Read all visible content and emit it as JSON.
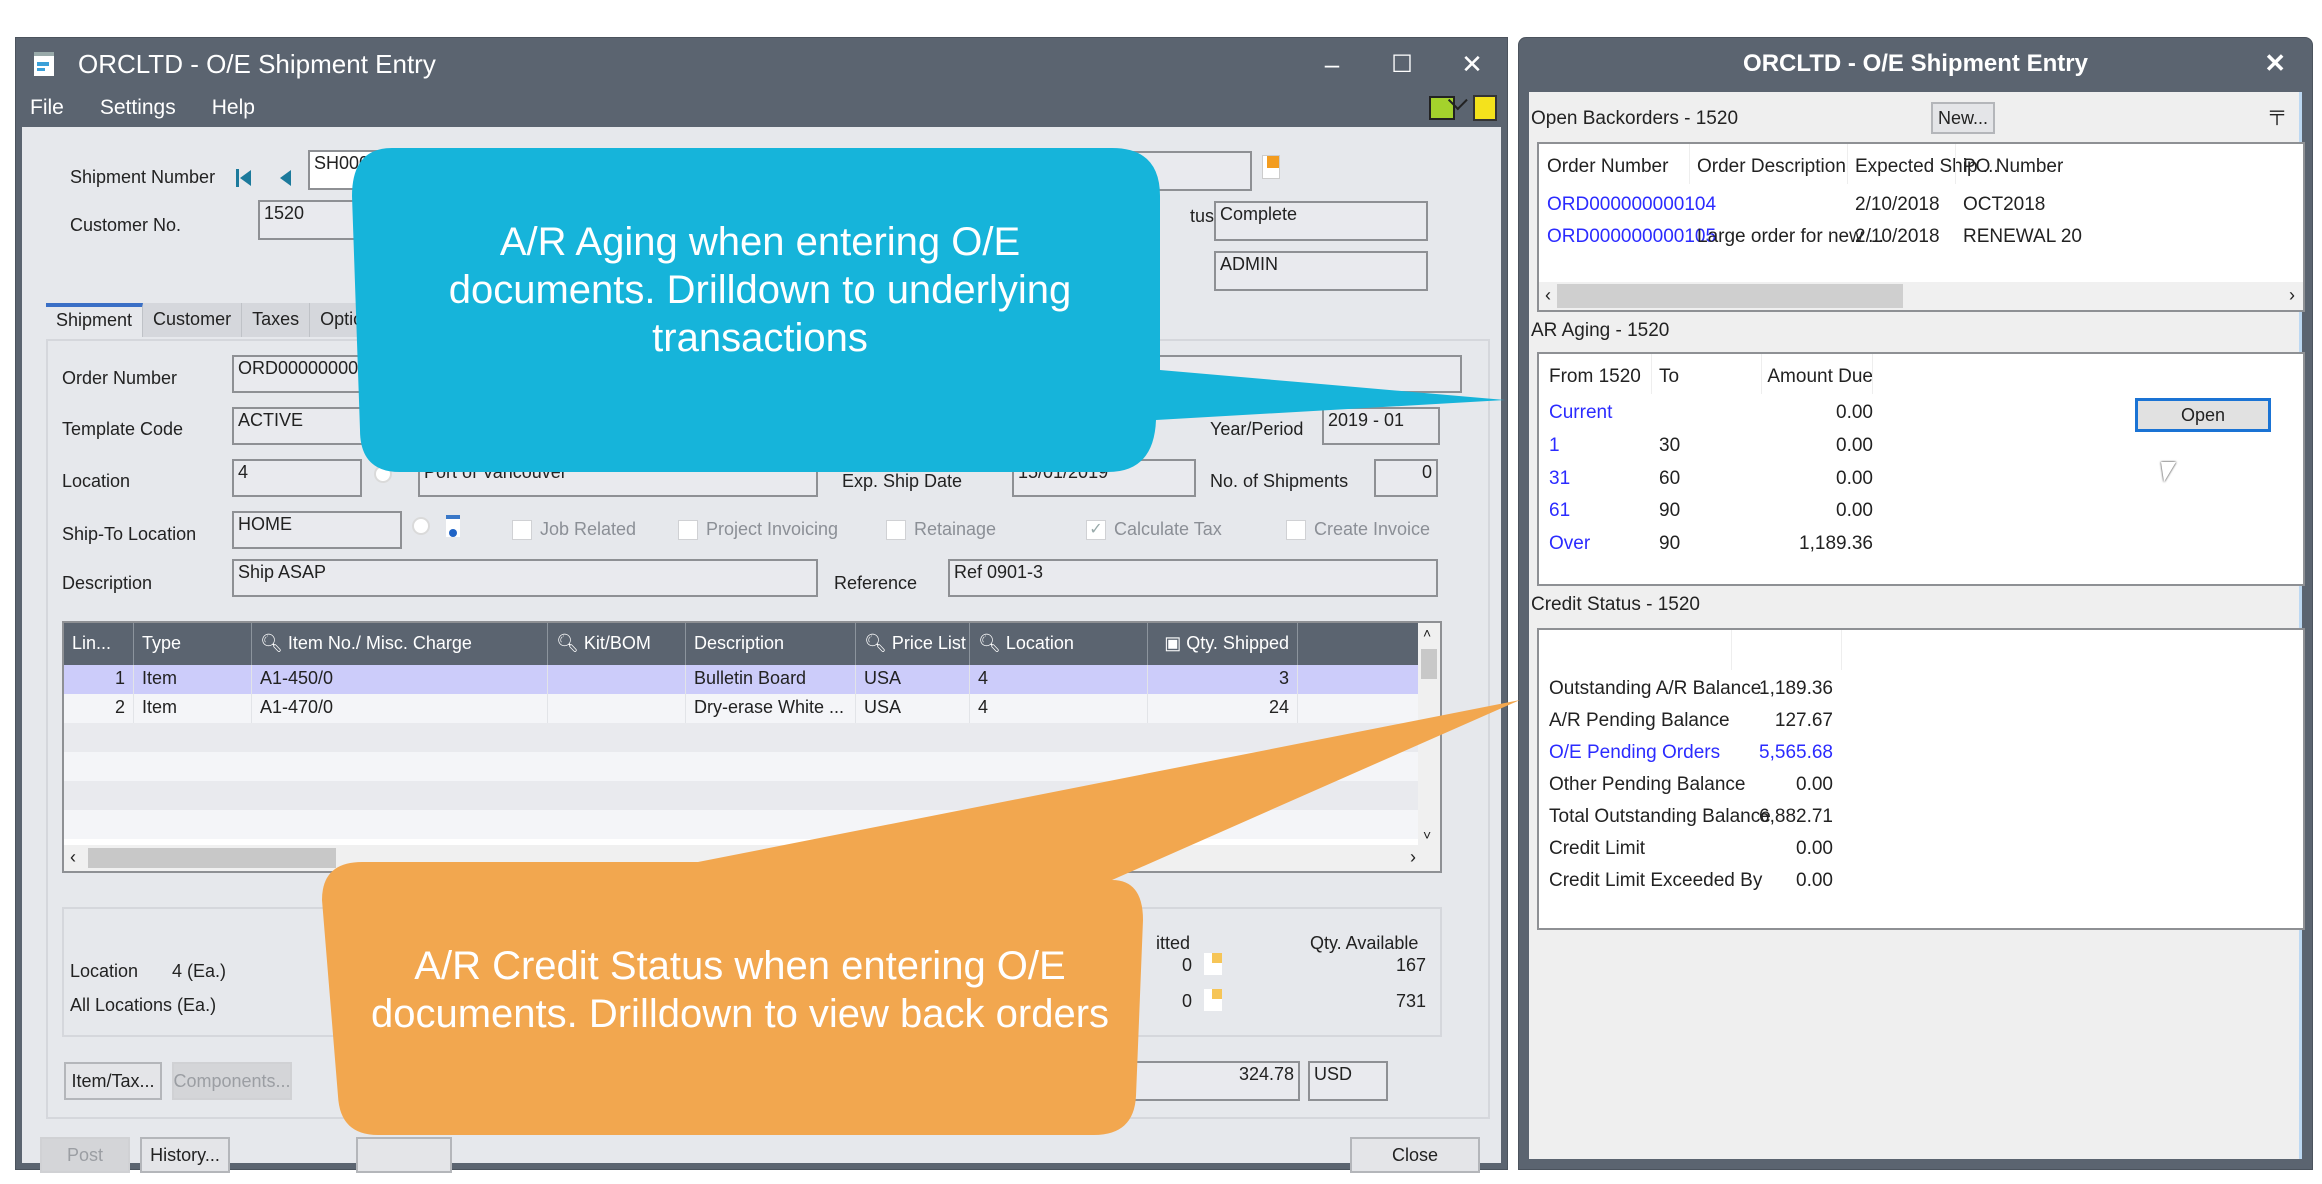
{
  "main_window": {
    "title": "ORCLTD - O/E Shipment Entry",
    "controls": {
      "minimize": "–",
      "maximize": "☐",
      "close": "✕"
    },
    "menu": [
      "File",
      "Settings",
      "Help"
    ],
    "header": {
      "shipment_number_label": "Shipment Number",
      "shipment_number_value": "SH000",
      "customer_no_label": "Customer No.",
      "customer_no_value": "1520",
      "status_label": "tus",
      "status_value": "Complete",
      "user_value": "ADMIN"
    },
    "tabs": [
      "Shipment",
      "Customer",
      "Taxes",
      "Optio"
    ],
    "form": {
      "order_number_label": "Order Number",
      "order_number_value": "ORD00000000",
      "template_code_label": "Template Code",
      "template_code_value": "ACTIVE",
      "year_period_label": "Year/Period",
      "year_period_value": "2019 - 01",
      "location_label": "Location",
      "location_value": "4",
      "location_desc": "Port of Vancouver",
      "exp_ship_date_label": "Exp. Ship Date",
      "exp_ship_date_value": "15/01/2019",
      "no_shipments_label": "No. of Shipments",
      "no_shipments_value": "0",
      "ship_to_label": "Ship-To Location",
      "ship_to_value": "HOME",
      "checkboxes": [
        {
          "label": "Job Related",
          "checked": false
        },
        {
          "label": "Project Invoicing",
          "checked": false
        },
        {
          "label": "Retainage",
          "checked": false
        },
        {
          "label": "Calculate Tax",
          "checked": true
        },
        {
          "label": "Create Invoice",
          "checked": false
        }
      ],
      "description_label": "Description",
      "description_value": "Ship ASAP",
      "reference_label": "Reference",
      "reference_value": "Ref 0901-3"
    },
    "grid": {
      "columns": [
        "Lin...",
        "Type",
        "Item No./ Misc. Charge",
        "Kit/BOM",
        "Description",
        "Price List",
        "Location",
        "Qty. Shipped"
      ],
      "rows": [
        [
          "1",
          "Item",
          "A1-450/0",
          "",
          "Bulletin Board",
          "USA",
          "4",
          "3"
        ],
        [
          "2",
          "Item",
          "A1-470/0",
          "",
          "Dry-erase White ...",
          "USA",
          "4",
          "24"
        ]
      ]
    },
    "availability": {
      "location_label": "Location",
      "location_value": "4 (Ea.)",
      "all_locations_label": "All Locations (Ea.)",
      "committed_header": "itted",
      "committed_values": [
        "0",
        "0"
      ],
      "qty_available_header": "Qty. Available",
      "qty_available_values": [
        "167",
        "731"
      ]
    },
    "buttons": {
      "item_tax": "Item/Tax...",
      "components": "Components...",
      "post": "Post",
      "history": "History...",
      "close": "Close"
    },
    "total_value": "324.78",
    "currency": "USD"
  },
  "side_window": {
    "title": "ORCLTD - O/E Shipment Entry",
    "close": "✕",
    "backorders": {
      "title": "Open Backorders - 1520",
      "new_button": "New...",
      "columns": [
        "Order Number",
        "Order Description",
        "Expected Ship ...",
        "PO Number"
      ],
      "rows": [
        [
          "ORD000000000104",
          "",
          "2/10/2018",
          "OCT2018"
        ],
        [
          "ORD000000000105",
          "Large order for new ...",
          "2/10/2018",
          "RENEWAL 20"
        ]
      ]
    },
    "aging": {
      "title": "AR Aging - 1520",
      "columns": [
        "From 1520",
        "To",
        "Amount Due"
      ],
      "rows": [
        [
          "Current",
          "",
          "0.00"
        ],
        [
          "1",
          "30",
          "0.00"
        ],
        [
          "31",
          "60",
          "0.00"
        ],
        [
          "61",
          "90",
          "0.00"
        ],
        [
          "Over",
          "90",
          "1,189.36"
        ]
      ],
      "open_button": "Open"
    },
    "credit": {
      "title": "Credit Status - 1520",
      "rows": [
        {
          "label": "Outstanding A/R Balance",
          "value": "1,189.36",
          "link": false
        },
        {
          "label": "A/R Pending Balance",
          "value": "127.67",
          "link": false
        },
        {
          "label": "O/E Pending Orders",
          "value": "5,565.68",
          "link": true
        },
        {
          "label": "Other Pending Balance",
          "value": "0.00",
          "link": false
        },
        {
          "label": "Total Outstanding Balance",
          "value": "6,882.71",
          "link": false
        },
        {
          "label": "Credit Limit",
          "value": "0.00",
          "link": false
        },
        {
          "label": "Credit Limit Exceeded By",
          "value": "0.00",
          "link": false
        }
      ]
    }
  },
  "callouts": {
    "aging": "A/R Aging when entering O/E documents. Drilldown to underlying transactions",
    "credit": "A/R Credit Status when entering O/E documents. Drilldown to view back orders"
  },
  "colors": {
    "titlebar": "#5b6470",
    "client": "#e6e8ec",
    "link": "#2b2bff",
    "selected_row": "#ccccfa",
    "callout_blue": "#16b4da",
    "callout_orange": "#f2a74f"
  }
}
